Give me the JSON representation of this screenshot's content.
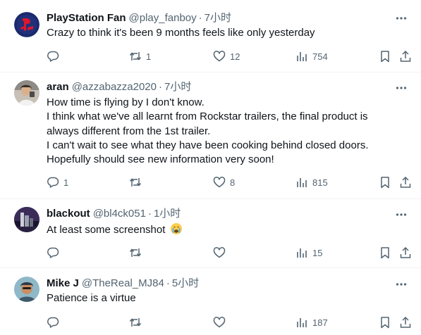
{
  "posts": [
    {
      "name": "PlayStation Fan",
      "handle": "@play_fanboy",
      "separator": "·",
      "time": "7小时",
      "lines": [
        "Crazy to think it's been 9 months feels like only yesterday"
      ],
      "avatar_icon": "ps-fan-avatar",
      "stats": {
        "replies": "",
        "reposts": "1",
        "likes": "12",
        "views": "754"
      }
    },
    {
      "name": "aran",
      "handle": "@azzabazza2020",
      "separator": "·",
      "time": "7小时",
      "lines": [
        "How time is flying by I don't know.",
        "I think what we've all learnt from Rockstar trailers, the final product is",
        "always different from the 1st trailer.",
        "I can't wait to see what they have been cooking behind closed doors.",
        "Hopefully should see new information very soon!"
      ],
      "avatar_icon": "person-avatar",
      "stats": {
        "replies": "1",
        "reposts": "",
        "likes": "8",
        "views": "815"
      }
    },
    {
      "name": "blackout",
      "handle": "@bl4ck051",
      "separator": "·",
      "time": "1小时",
      "lines": [
        "At least some screenshot"
      ],
      "emoji": "crying-face-emoji",
      "avatar_icon": "city-avatar",
      "stats": {
        "replies": "",
        "reposts": "",
        "likes": "",
        "views": "15"
      }
    },
    {
      "name": "Mike J",
      "handle": "@TheReal_MJ84",
      "separator": "·",
      "time": "5小时",
      "lines": [
        "Patience is a virtue"
      ],
      "avatar_icon": "person-avatar",
      "stats": {
        "replies": "",
        "reposts": "",
        "likes": "",
        "views": "187"
      }
    }
  ],
  "colors": {
    "text": "#0f1419",
    "muted": "#536471",
    "divider": "#eff3f4"
  }
}
